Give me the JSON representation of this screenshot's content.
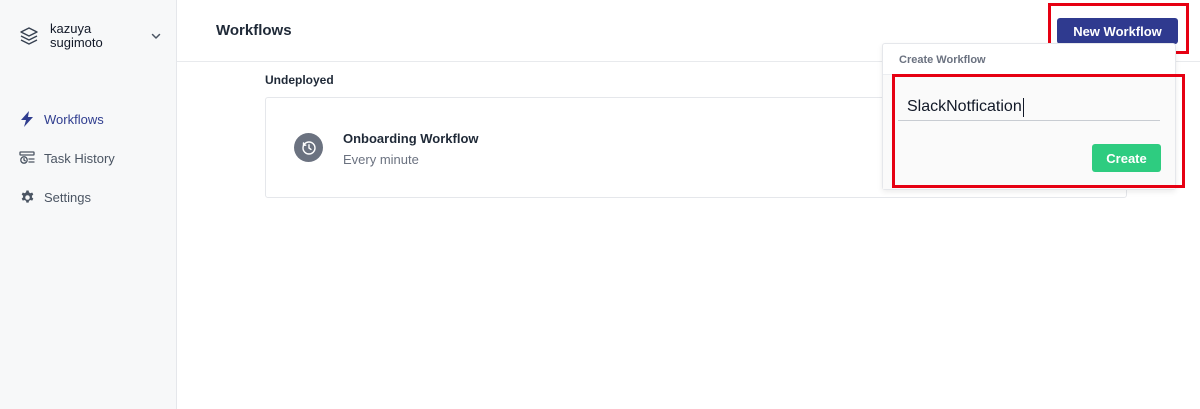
{
  "account": {
    "name_line1": "kazuya",
    "name_line2": "sugimoto"
  },
  "sidebar": {
    "items": [
      {
        "label": "Workflows",
        "icon": "bolt-icon",
        "active": true
      },
      {
        "label": "Task History",
        "icon": "history-icon",
        "active": false
      },
      {
        "label": "Settings",
        "icon": "gear-icon",
        "active": false
      }
    ]
  },
  "header": {
    "title": "Workflows",
    "new_workflow_label": "New Workflow"
  },
  "main": {
    "section_label": "Undeployed",
    "workflows": [
      {
        "name": "Onboarding Workflow",
        "schedule": "Every minute",
        "icon": "clock-icon"
      }
    ]
  },
  "create_popover": {
    "title": "Create Workflow",
    "input_value": "SlackNotfication",
    "create_label": "Create"
  },
  "colors": {
    "primary": "#2f3a8f",
    "success": "#2ecc80",
    "highlight": "#e60012",
    "sidebar_bg": "#f7f8f9"
  }
}
